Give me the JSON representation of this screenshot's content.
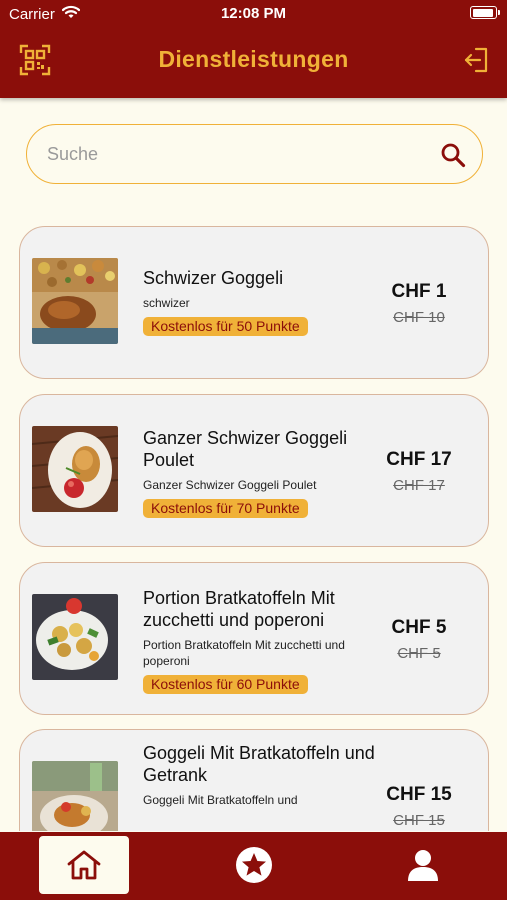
{
  "status_bar": {
    "carrier": "Carrier",
    "time": "12:08 PM"
  },
  "header": {
    "title": "Dienstleistungen"
  },
  "search": {
    "placeholder": "Suche"
  },
  "services": [
    {
      "name": "Schwizer Goggeli",
      "description": "schwizer",
      "badge": "Kostenlos für 50 Punkte",
      "price": "CHF 1",
      "old_price": "CHF 10"
    },
    {
      "name": "Ganzer Schwizer  Goggeli Poulet",
      "description": "Ganzer Schwizer  Goggeli  Poulet",
      "badge": "Kostenlos für 70 Punkte",
      "price": "CHF 17",
      "old_price": "CHF 17"
    },
    {
      "name": "Portion Bratkatoffeln Mit zucchetti und poperoni",
      "description": "Portion Bratkatoffeln Mit zucchetti und poperoni",
      "badge": "Kostenlos für 60 Punkte",
      "price": "CHF 5",
      "old_price": "CHF 5"
    },
    {
      "name": "Goggeli   Mit Bratkatoffeln  und Getrank",
      "description": "Goggeli   Mit Bratkatoffeln  und",
      "badge": "",
      "price": "CHF 15",
      "old_price": "CHF 15"
    }
  ],
  "tab_bar": {
    "tabs": [
      "home-icon",
      "star-icon",
      "user-icon"
    ],
    "active": "home-icon"
  },
  "colors": {
    "primary": "#8b0e0a",
    "accent": "#f0b138",
    "background": "#fdfbee",
    "card": "#f2f2f2"
  }
}
